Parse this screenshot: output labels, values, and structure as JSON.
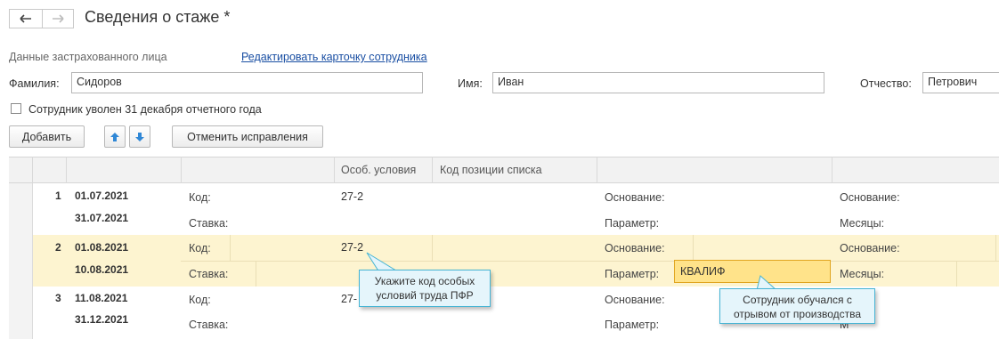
{
  "header": {
    "title": "Сведения о стаже *",
    "back_icon": "arrow-left-icon",
    "forward_icon": "arrow-right-icon"
  },
  "insured": {
    "section_label": "Данные застрахованного лица",
    "edit_link": "Редактировать карточку сотрудника"
  },
  "fields": {
    "surname_label": "Фамилия:",
    "surname_value": "Сидоров",
    "name_label": "Имя:",
    "name_value": "Иван",
    "patronymic_label": "Отчество:",
    "patronymic_value": "Петрович"
  },
  "dismissed_checkbox": {
    "label": "Сотрудник уволен 31 декабря отчетного года",
    "checked": false
  },
  "toolbar": {
    "add_label": "Добавить",
    "up_icon": "arrow-up-icon",
    "down_icon": "arrow-down-icon",
    "cancel_label": "Отменить исправления"
  },
  "table": {
    "headers": [
      "",
      "",
      "",
      "Особ. условия",
      "Код позиции списка",
      "",
      ""
    ],
    "rows": [
      {
        "num": "1",
        "start": "01.07.2021",
        "end": "31.07.2021",
        "code_label": "Код:",
        "code_value": "27-2",
        "rate_label": "Ставка:",
        "basis_label": "Основание:",
        "param_label": "Параметр:",
        "param_value": "",
        "basis2_label": "Основание:",
        "months_label": "Месяцы:"
      },
      {
        "num": "2",
        "start": "01.08.2021",
        "end": "10.08.2021",
        "code_label": "Код:",
        "code_value": "27-2",
        "rate_label": "Ставка:",
        "basis_label": "Основание:",
        "param_label": "Параметр:",
        "param_value": "КВАЛИФ",
        "basis2_label": "Основание:",
        "months_label": "Месяцы:"
      },
      {
        "num": "3",
        "start": "11.08.2021",
        "end": "31.12.2021",
        "code_label": "Код:",
        "code_value": "27-",
        "rate_label": "Ставка:",
        "basis_label": "Основание:",
        "param_label": "Параметр:",
        "param_value": "",
        "basis2_label": "О",
        "months_label": "М"
      }
    ],
    "selected_row_color": "#fdf4d0"
  },
  "tooltips": {
    "code_hint": "Укажите код особых условий труда ПФР",
    "param_hint": "Сотрудник обучался с отрывом от производства"
  }
}
